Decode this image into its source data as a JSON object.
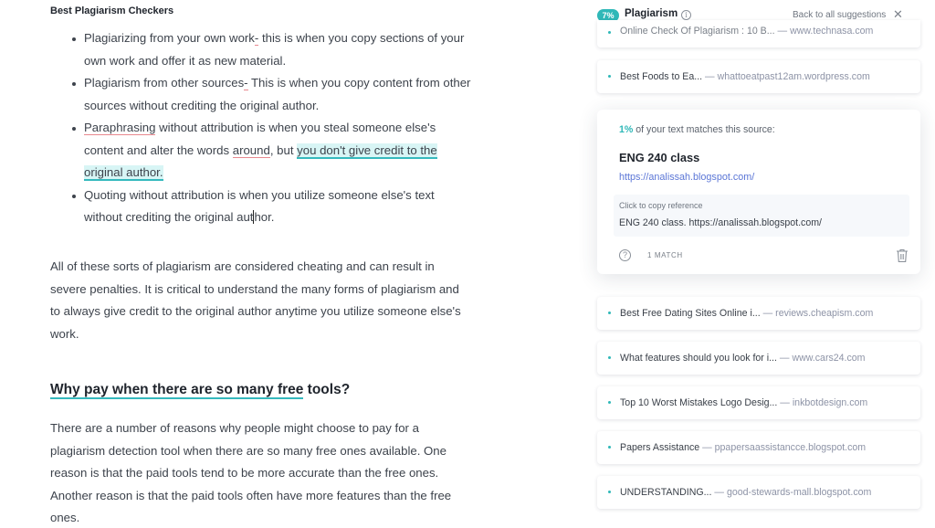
{
  "editor": {
    "doc_title": "Best Plagiarism Checkers",
    "bullets": [
      {
        "pre": "Plagiarizing from your own work",
        "err": "-",
        "post": " this is when you copy sections of your own work and offer it as new material."
      },
      {
        "pre": "Plagiarism from other sources",
        "err": "-",
        "post": " This is when you copy content from other sources without crediting the original author."
      },
      {
        "err1": "Paraphrasing",
        "mid1": " without attribution is when you steal someone else's content and alter the words ",
        "err2": "around",
        "mid2": ", but ",
        "highlight": "you don't give credit to the original author."
      },
      {
        "pre": "Quoting without attribution is when you utilize someone else's text without crediting the original aut",
        "post": "hor."
      }
    ],
    "paragraph1": "All of these sorts of plagiarism are considered cheating and can result in severe penalties. It is critical to understand the many forms of plagiarism and to always give credit to the original author anytime you utilize someone else's work.",
    "heading": {
      "underlined": "Why pay when there are so many free",
      "rest": " tools?"
    },
    "paragraph2": "There are a number of reasons why people might choose to pay for a plagiarism detection tool when there are so many free ones available. One reason is that the paid tools tend to be more accurate than the free ones. Another reason is that the paid tools often have more features than the free ones."
  },
  "sidebar": {
    "score": "7%",
    "title": "Plagiarism",
    "info_icon": "info-icon",
    "back_label": "Back to all suggestions",
    "close_icon": "close-icon",
    "accent_color": "#2fb8b8",
    "sources_top": [
      {
        "title": "Online Check Of Plagiarism : 10 B...",
        "domain": "— www.technasa.com"
      },
      {
        "title": "Best Foods to Ea...",
        "domain": "— whattoeatpast12am.wordpress.com"
      }
    ],
    "detail": {
      "percent": "1%",
      "match_text": " of your text matches this source:",
      "source_title": "ENG 240 class",
      "source_url": "https://analissah.blogspot.com/",
      "copy_label": "Click to copy reference",
      "copy_text": "ENG 240 class. https://analissah.blogspot.com/",
      "match_count": "1 MATCH",
      "help_icon": "help-icon",
      "delete_icon": "trash-icon"
    },
    "sources_bottom": [
      {
        "title": "Best Free Dating Sites Online i...",
        "domain": "— reviews.cheapism.com"
      },
      {
        "title": "What features should you look for i...",
        "domain": "— www.cars24.com"
      },
      {
        "title": "Top 10 Worst Mistakes Logo Desig...",
        "domain": "— inkbotdesign.com"
      },
      {
        "title": "Papers Assistance",
        "domain": "— ppapersaassistancce.blogspot.com"
      },
      {
        "title": "UNDERSTANDING...",
        "domain": "— good-stewards-mall.blogspot.com"
      }
    ]
  }
}
